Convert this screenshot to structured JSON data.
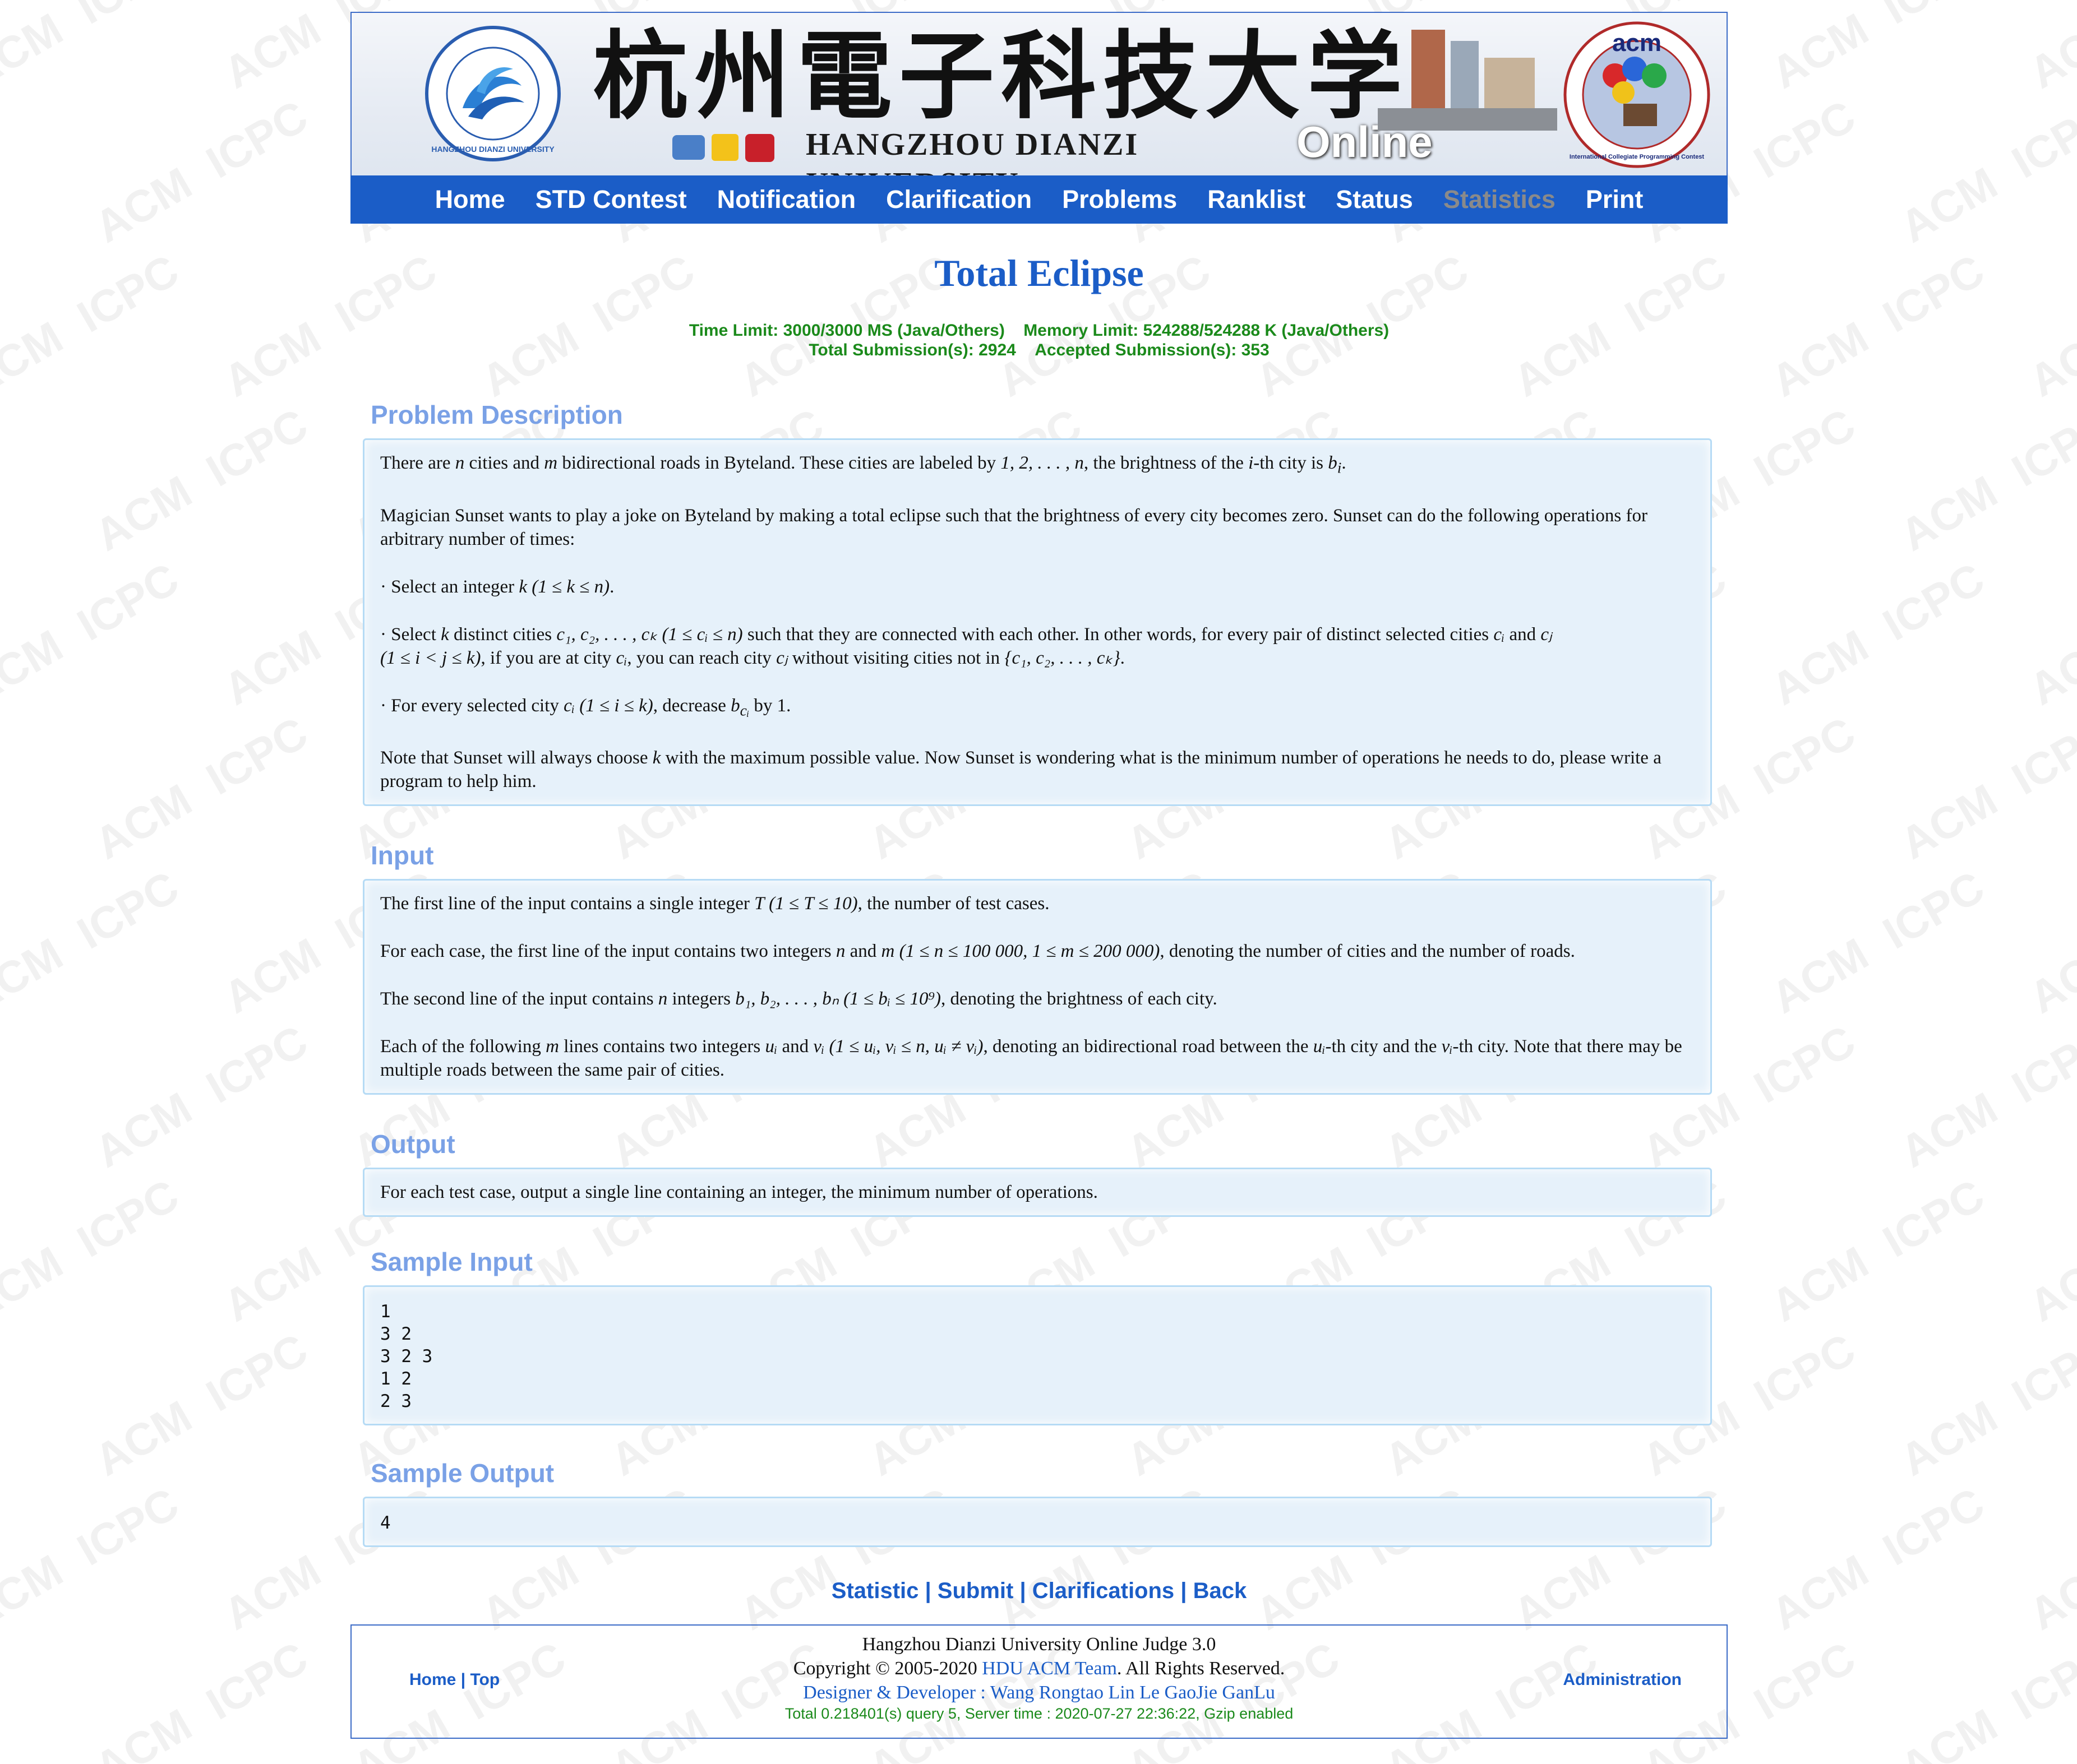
{
  "banner": {
    "cn_title": "杭州電子科技大学",
    "en_title": "HANGZHOU DIANZI UNIVERSITY",
    "oj_title": "Online Judge",
    "acm_logo_text": "acm",
    "acm_ring_text": "International Collegiate Programming Contest",
    "seal_ring_text": "HANGZHOU DIANZI UNIVERSITY"
  },
  "nav": {
    "home": "Home",
    "std_contest": "STD Contest",
    "notification": "Notification",
    "clarification": "Clarification",
    "problems": "Problems",
    "ranklist": "Ranklist",
    "status": "Status",
    "statistics": "Statistics",
    "print": "Print"
  },
  "watermark": {
    "text_a": "ACM",
    "text_b": "ICPC"
  },
  "problem": {
    "title": "Total Eclipse",
    "time_limit": "Time Limit: 3000/3000 MS (Java/Others)",
    "memory_limit": "Memory Limit: 524288/524288 K (Java/Others)",
    "total_submissions": "Total Submission(s): 2924",
    "accepted_submissions": "Accepted Submission(s): 353"
  },
  "sections": {
    "description_heading": "Problem Description",
    "input_heading": "Input",
    "output_heading": "Output",
    "sample_input_heading": "Sample Input",
    "sample_output_heading": "Sample Output"
  },
  "description": {
    "p1_a": "There are ",
    "p1_n": "n",
    "p1_b": " cities and ",
    "p1_m": "m",
    "p1_c": " bidirectional roads in Byteland. These cities are labeled by ",
    "p1_seq": "1, 2, . . . , n",
    "p1_d": ", the brightness of the ",
    "p1_i": "i",
    "p1_e": "-th city is ",
    "p1_bi": "b",
    "p1_bi_sub": "i",
    "p1_f": ".",
    "p2": "Magician Sunset wants to play a joke on Byteland by making a total eclipse such that the brightness of every city becomes zero. Sunset can do the following operations for arbitrary number of times:",
    "p3_a": "· Select an integer ",
    "p3_k": "k",
    "p3_cond": " (1 ≤ k ≤ n)",
    "p3_b": ".",
    "p4_a": "· Select ",
    "p4_k": "k",
    "p4_b": " distinct cities ",
    "p4_seq": "c₁, c₂, . . . , cₖ",
    "p4_cond": " (1 ≤ cᵢ ≤ n)",
    "p4_c": " such that they are connected with each other. In other words, for every pair of distinct selected cities ",
    "p4_ci": "cᵢ",
    "p4_and": " and ",
    "p4_cj": "cⱼ",
    "p4_cond2": "(1 ≤ i < j ≤ k)",
    "p4_d": ", if you are at city ",
    "p4_ci2": "cᵢ",
    "p4_e": ", you can reach city ",
    "p4_cj2": "cⱼ",
    "p4_f": " without visiting cities not in ",
    "p4_set": "{c₁, c₂, . . . , cₖ}",
    "p4_g": ".",
    "p5_a": "· For every selected city ",
    "p5_ci": "cᵢ",
    "p5_cond": " (1 ≤ i ≤ k)",
    "p5_b": ", decrease ",
    "p5_b_var": "b",
    "p5_b_sub": "cᵢ",
    "p5_c": " by 1.",
    "p6_a": "Note that Sunset will always choose ",
    "p6_k": "k",
    "p6_b": " with the maximum possible value. Now Sunset is wondering what is the minimum number of operations he needs to do, please write a program to help him."
  },
  "input": {
    "p1_a": "The first line of the input contains a single integer ",
    "p1_T": "T",
    "p1_cond": " (1 ≤ T ≤ 10)",
    "p1_b": ", the number of test cases.",
    "p2_a": "For each case, the first line of the input contains two integers ",
    "p2_n": "n",
    "p2_and": " and ",
    "p2_m": "m",
    "p2_cond": " (1 ≤ n ≤ 100 000, 1 ≤ m ≤ 200 000)",
    "p2_b": ", denoting the number of cities and the number of roads.",
    "p3_a": "The second line of the input contains ",
    "p3_n": "n",
    "p3_b": " integers ",
    "p3_seq": "b₁, b₂, . . . , bₙ",
    "p3_cond": " (1 ≤ bᵢ ≤ 10⁹)",
    "p3_c": ", denoting the brightness of each city.",
    "p4_a": "Each of the following ",
    "p4_m": "m",
    "p4_b": " lines contains two integers ",
    "p4_u": "uᵢ",
    "p4_and": " and ",
    "p4_v": "vᵢ",
    "p4_cond": " (1 ≤ uᵢ, vᵢ ≤ n, uᵢ ≠ vᵢ)",
    "p4_c": ", denoting an bidirectional road between the ",
    "p4_u2": "uᵢ",
    "p4_d": "-th city and the ",
    "p4_v2": "vᵢ",
    "p4_e": "-th city. Note that there may be multiple roads between the same pair of cities."
  },
  "output": {
    "text": "For each test case, output a single line containing an integer, the minimum number of operations."
  },
  "sample_input": {
    "text": "1\n3 2\n3 2 3\n1 2\n2 3"
  },
  "sample_output": {
    "text": "4"
  },
  "bottom_links": {
    "statistic": "Statistic",
    "submit": "Submit",
    "clarifications": "Clarifications",
    "back": "Back",
    "sep": " | "
  },
  "footer": {
    "home": "Home",
    "top": "Top",
    "sep": " | ",
    "line1": "Hangzhou Dianzi University Online Judge 3.0",
    "line2_a": "Copyright © 2005-2020 ",
    "line2_team": "HDU ACM Team",
    "line2_b": ". All Rights Reserved.",
    "line3": "Designer & Developer : Wang Rongtao Lin Le GaoJie GanLu",
    "line4": "Total 0.218401(s) query 5, Server time : 2020-07-27 22:36:22, Gzip enabled",
    "admin": "Administration"
  },
  "colors": {
    "nav_bg": "#1b5dc7",
    "title_blue": "#1b5dc7",
    "limit_green": "#1b8a1b",
    "section_heading": "#7aa1e6",
    "panel_bg": "#e6f1fa",
    "panel_border": "#b6dbf5",
    "inactive_nav": "#8a8a8a"
  }
}
